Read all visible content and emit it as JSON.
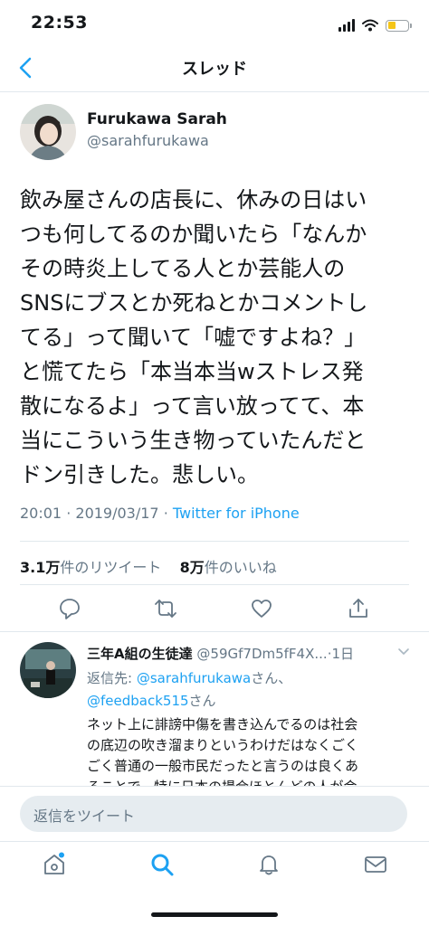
{
  "status_bar": {
    "time": "22:53"
  },
  "nav": {
    "title": "スレッド",
    "back_icon": "chevron-left-icon"
  },
  "tweet": {
    "author_name": "Furukawa Sarah",
    "author_handle": "@sarahfurukawa",
    "text_lines": [
      "飲み屋さんの店長に、休みの日はい",
      "つも何してるのか聞いたら「なんか",
      "その時炎上してる人とか芸能人の",
      "SNSにブスとか死ねとかコメントし",
      "てる」って聞いて「嘘ですよね？」",
      "と慌てたら「本当本当wストレス発",
      "散になるよ」って言い放ってて、本",
      "当にこういう生き物っていたんだと",
      "ドン引きした。悲しい。"
    ],
    "time": "20:01",
    "date": "2019/03/17",
    "separator": "·",
    "source": "Twitter for iPhone",
    "retweet_count": "3.1万",
    "retweet_label": "件のリツイート",
    "like_count": "8万",
    "like_label": "件のいいね"
  },
  "reply": {
    "author_name": "三年A組の生徒達",
    "author_handle": "@59Gf7Dm5fF4X...",
    "time_ago": "·1日",
    "reply_to_label": "返信先:",
    "reply_to_user1": "@sarahfurukawa",
    "reply_to_suffix1": "さん、",
    "reply_to_user2": "@feedback515",
    "reply_to_suffix2": "さん",
    "text_lines": [
      "ネット上に誹謗中傷を書き込んでるのは社会",
      "の底辺の吹き溜まりというわけだはなくごく",
      "ごく普通の一般市民だったと言うのは良くあ",
      "ることで、特に日本の場合ほとんどの人が会"
    ]
  },
  "compose": {
    "placeholder": "返信をツイート"
  },
  "colors": {
    "accent": "#1da1f2",
    "secondary_text": "#657786",
    "divider": "#e1e8ed"
  }
}
